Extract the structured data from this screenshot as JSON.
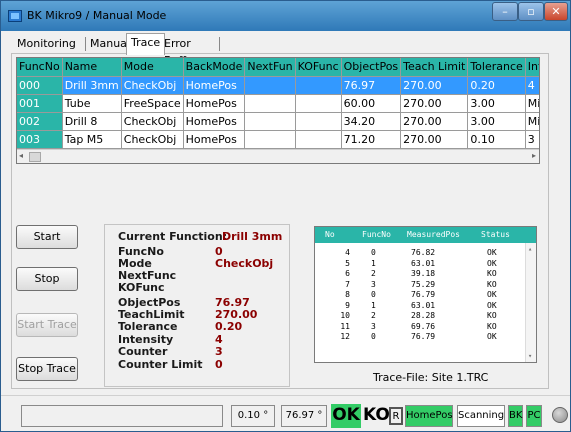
{
  "window": {
    "title": "BK Mikro9 / Manual Mode",
    "min_label": "–",
    "max_label": "▫",
    "close_label": "✕"
  },
  "tabs": [
    {
      "label": "Monitoring"
    },
    {
      "label": "Manual"
    },
    {
      "label": "Trace"
    },
    {
      "label": "Error Buffer"
    }
  ],
  "active_tab": "Trace",
  "grid": {
    "columns": [
      "FuncNo",
      "Name",
      "Mode",
      "BackMode",
      "NextFun",
      "KOFunc",
      "ObjectPos",
      "Teach Limit",
      "Tolerance",
      "Intensity"
    ],
    "rows": [
      [
        "000",
        "Drill 3mm",
        "CheckObj",
        "HomePos",
        "",
        "",
        "76.97",
        "270.00",
        "0.20",
        "4"
      ],
      [
        "001",
        "Tube",
        "FreeSpace",
        "HomePos",
        "",
        "",
        "60.00",
        "270.00",
        "3.00",
        "Min"
      ],
      [
        "002",
        "Drill 8",
        "CheckObj",
        "HomePos",
        "",
        "",
        "34.20",
        "270.00",
        "3.00",
        "Min"
      ],
      [
        "003",
        "Tap M5",
        "CheckObj",
        "HomePos",
        "",
        "",
        "71.20",
        "270.00",
        "0.10",
        "3"
      ]
    ],
    "selected_row": 0,
    "scroll_left": "◂",
    "scroll_right": "▸"
  },
  "buttons": {
    "start": "Start",
    "stop": "Stop",
    "start_trace": "Start Trace",
    "stop_trace": "Stop Trace"
  },
  "current_function": {
    "title_label": "Current  Function:",
    "title_value": "Drill 3mm",
    "fields": [
      {
        "label": "FuncNo",
        "value": "0"
      },
      {
        "label": "Mode",
        "value": "CheckObj"
      },
      {
        "label": "NextFunc",
        "value": ""
      },
      {
        "label": "KOFunc",
        "value": ""
      },
      {
        "label": "ObjectPos",
        "value": "76.97"
      },
      {
        "label": "TeachLimit",
        "value": "270.00"
      },
      {
        "label": "Tolerance",
        "value": "0.20"
      },
      {
        "label": "Intensity",
        "value": "4"
      },
      {
        "label": "Counter",
        "value": "3"
      },
      {
        "label": "Counter Limit",
        "value": "0"
      }
    ]
  },
  "log": {
    "headers": [
      "No",
      "FuncNo",
      "MeasuredPos",
      "Status"
    ],
    "rows": [
      [
        "4",
        "0",
        "76.82",
        "OK"
      ],
      [
        "5",
        "1",
        "63.01",
        "OK"
      ],
      [
        "6",
        "2",
        "39.18",
        "KO"
      ],
      [
        "7",
        "3",
        "75.29",
        "KO"
      ],
      [
        "8",
        "0",
        "76.79",
        "OK"
      ],
      [
        "9",
        "1",
        "63.01",
        "OK"
      ],
      [
        "10",
        "2",
        "28.28",
        "KO"
      ],
      [
        "11",
        "3",
        "69.76",
        "KO"
      ],
      [
        "12",
        "0",
        "76.79",
        "OK"
      ]
    ],
    "scroll_up": "▴",
    "scroll_down": "▾"
  },
  "trace_file": "Trace-File: Site 1.TRC",
  "status": {
    "message": "",
    "angle1": "0.10 °",
    "angle2": "76.97 °",
    "ok": "OK",
    "ko": "KO",
    "r": "R",
    "homepos": "HomePos",
    "scanning": "Scanning",
    "bk": "BK",
    "pc": "PC",
    "green": "#33cc66"
  },
  "colors": {
    "header_teal": "#2ab5a8",
    "selection_blue": "#3399ff",
    "value_red": "#8b0000"
  }
}
